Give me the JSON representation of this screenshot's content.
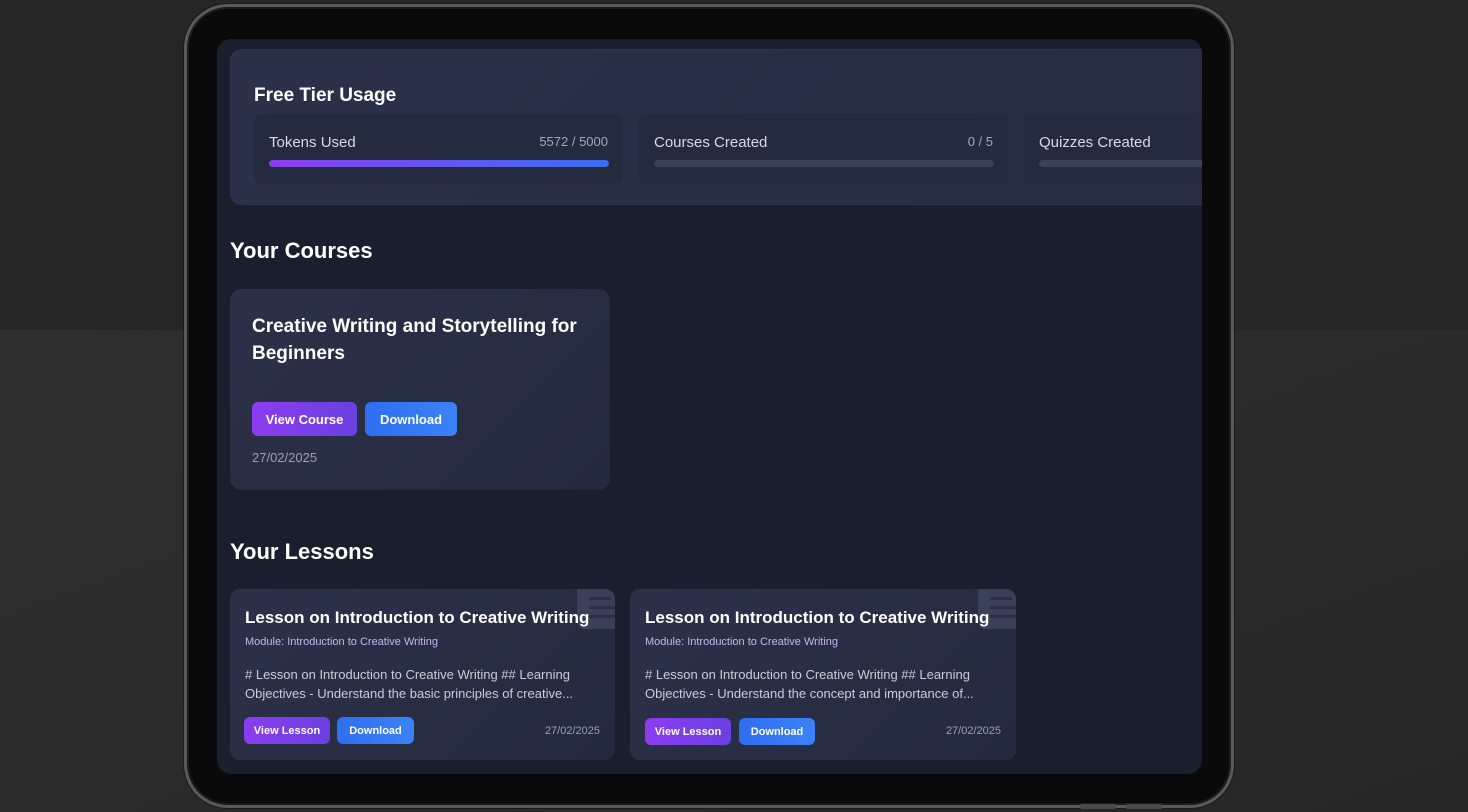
{
  "usage": {
    "title": "Free Tier Usage",
    "cards": [
      {
        "label": "Tokens Used",
        "count": "5572 / 5000",
        "progress": 1.0
      },
      {
        "label": "Courses Created",
        "count": "0 / 5",
        "progress": 0
      },
      {
        "label": "Quizzes Created",
        "count": "",
        "progress": 0
      }
    ]
  },
  "courses": {
    "section_title": "Your Courses",
    "items": [
      {
        "title": "Creative Writing and Storytelling for Beginners",
        "view_label": "View Course",
        "download_label": "Download",
        "date": "27/02/2025"
      }
    ]
  },
  "lessons": {
    "section_title": "Your Lessons",
    "items": [
      {
        "title": "Lesson on Introduction to Creative Writing",
        "module": "Module: Introduction to Creative Writing",
        "description": "# Lesson on Introduction to Creative Writing ## Learning Objectives - Understand the basic principles of creative...",
        "view_label": "View Lesson",
        "download_label": "Download",
        "date": "27/02/2025"
      },
      {
        "title": "Lesson on Introduction to Creative Writing",
        "module": "Module: Introduction to Creative Writing",
        "description": "# Lesson on Introduction to Creative Writing ## Learning Objectives - Understand the concept and importance of...",
        "view_label": "View Lesson",
        "download_label": "Download",
        "date": "27/02/2025"
      }
    ]
  },
  "colors": {
    "accent_purple": "#8b3df0",
    "accent_blue": "#3b82f6",
    "screen_bg": "#1a1f2e"
  }
}
